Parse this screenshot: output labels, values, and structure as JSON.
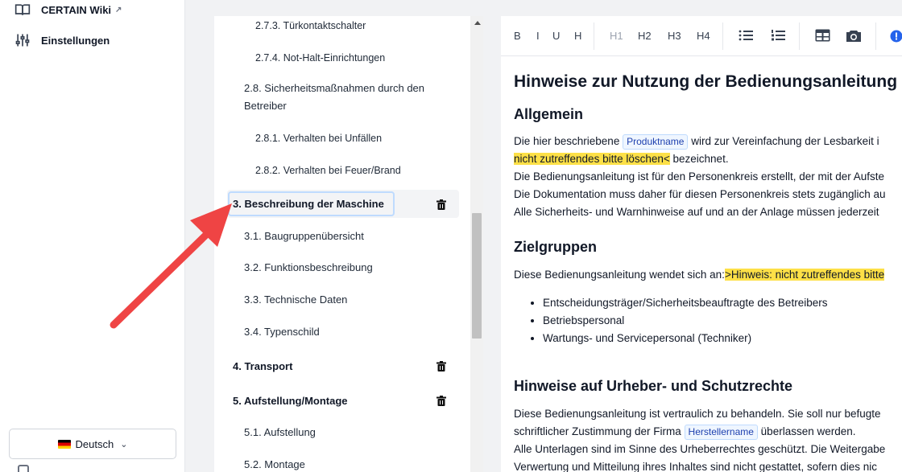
{
  "sidebar": {
    "wiki_label": "CERTAIN Wiki",
    "settings_label": "Einstellungen",
    "language": "Deutsch"
  },
  "toc": {
    "items": [
      {
        "label": "2.7.3. Türkontaktschalter"
      },
      {
        "label": "2.7.4. Not-Halt-Einrichtungen"
      },
      {
        "label": "2.8. Sicherheitsmaßnahmen durch den"
      },
      {
        "label": "Betreiber"
      },
      {
        "label": "2.8.1. Verhalten bei Unfällen"
      },
      {
        "label": "2.8.2. Verhalten bei Feuer/Brand"
      },
      {
        "label": "3. Beschreibung der Maschine"
      },
      {
        "label": "3.1. Baugruppenübersicht"
      },
      {
        "label": "3.2. Funktionsbeschreibung"
      },
      {
        "label": "3.3. Technische Daten"
      },
      {
        "label": "3.4. Typenschild"
      },
      {
        "label": "4. Transport"
      },
      {
        "label": "5. Aufstellung/Montage"
      },
      {
        "label": "5.1. Aufstellung"
      },
      {
        "label": "5.2. Montage"
      }
    ]
  },
  "toolbar": {
    "bold": "B",
    "italic": "I",
    "underline": "U",
    "heading": "H",
    "h1": "H1",
    "h2": "H2",
    "h3": "H3",
    "h4": "H4"
  },
  "editor": {
    "title": "Hinweise zur Nutzung der Bedienungsanleitung",
    "sec1_heading": "Allgemein",
    "sec1_p1_a": "Die hier beschriebene ",
    "sec1_tag1": "Produktname",
    "sec1_p1_b": " wird zur Vereinfachung der Lesbarkeit i",
    "sec1_hl1": "nicht zutreffendes bitte löschen<",
    "sec1_p2_b": " bezeichnet.",
    "sec1_p3": "Die Bedienungsanleitung ist für den Personenkreis erstellt, der mit der Aufste",
    "sec1_p4": "Die Dokumentation muss daher für diesen Personenkreis stets zugänglich au",
    "sec1_p5": "Alle Sicherheits- und Warnhinweise auf und an der Anlage müssen jederzeit",
    "sec2_heading": "Zielgruppen",
    "sec2_p1_a": "Diese Bedienungsanleitung wendet sich an:",
    "sec2_hl1": ">Hinweis: nicht zutreffendes bitte",
    "sec2_list": [
      "Entscheidungsträger/Sicherheitsbeauftragte des Betreibers",
      "Betriebspersonal",
      "Wartungs- und Servicepersonal (Techniker)"
    ],
    "sec3_heading": "Hinweise auf Urheber- und Schutzrechte",
    "sec3_p1": "Diese Bedienungsanleitung ist vertraulich zu behandeln. Sie soll nur befugte",
    "sec3_p2_a": "schriftlicher Zustimmung der Firma ",
    "sec3_tag1": "Herstellername",
    "sec3_p2_b": " überlassen werden.",
    "sec3_p3": "Alle Unterlagen sind im Sinne des Urheberrechtes geschützt. Die Weitergabe",
    "sec3_p4": "Verwertung und Mitteilung ihres Inhaltes sind nicht gestattet, sofern dies nic"
  },
  "colors": {
    "highlight": "#fde047",
    "arrow": "#ef4444",
    "tag_bg": "#eff6ff"
  }
}
